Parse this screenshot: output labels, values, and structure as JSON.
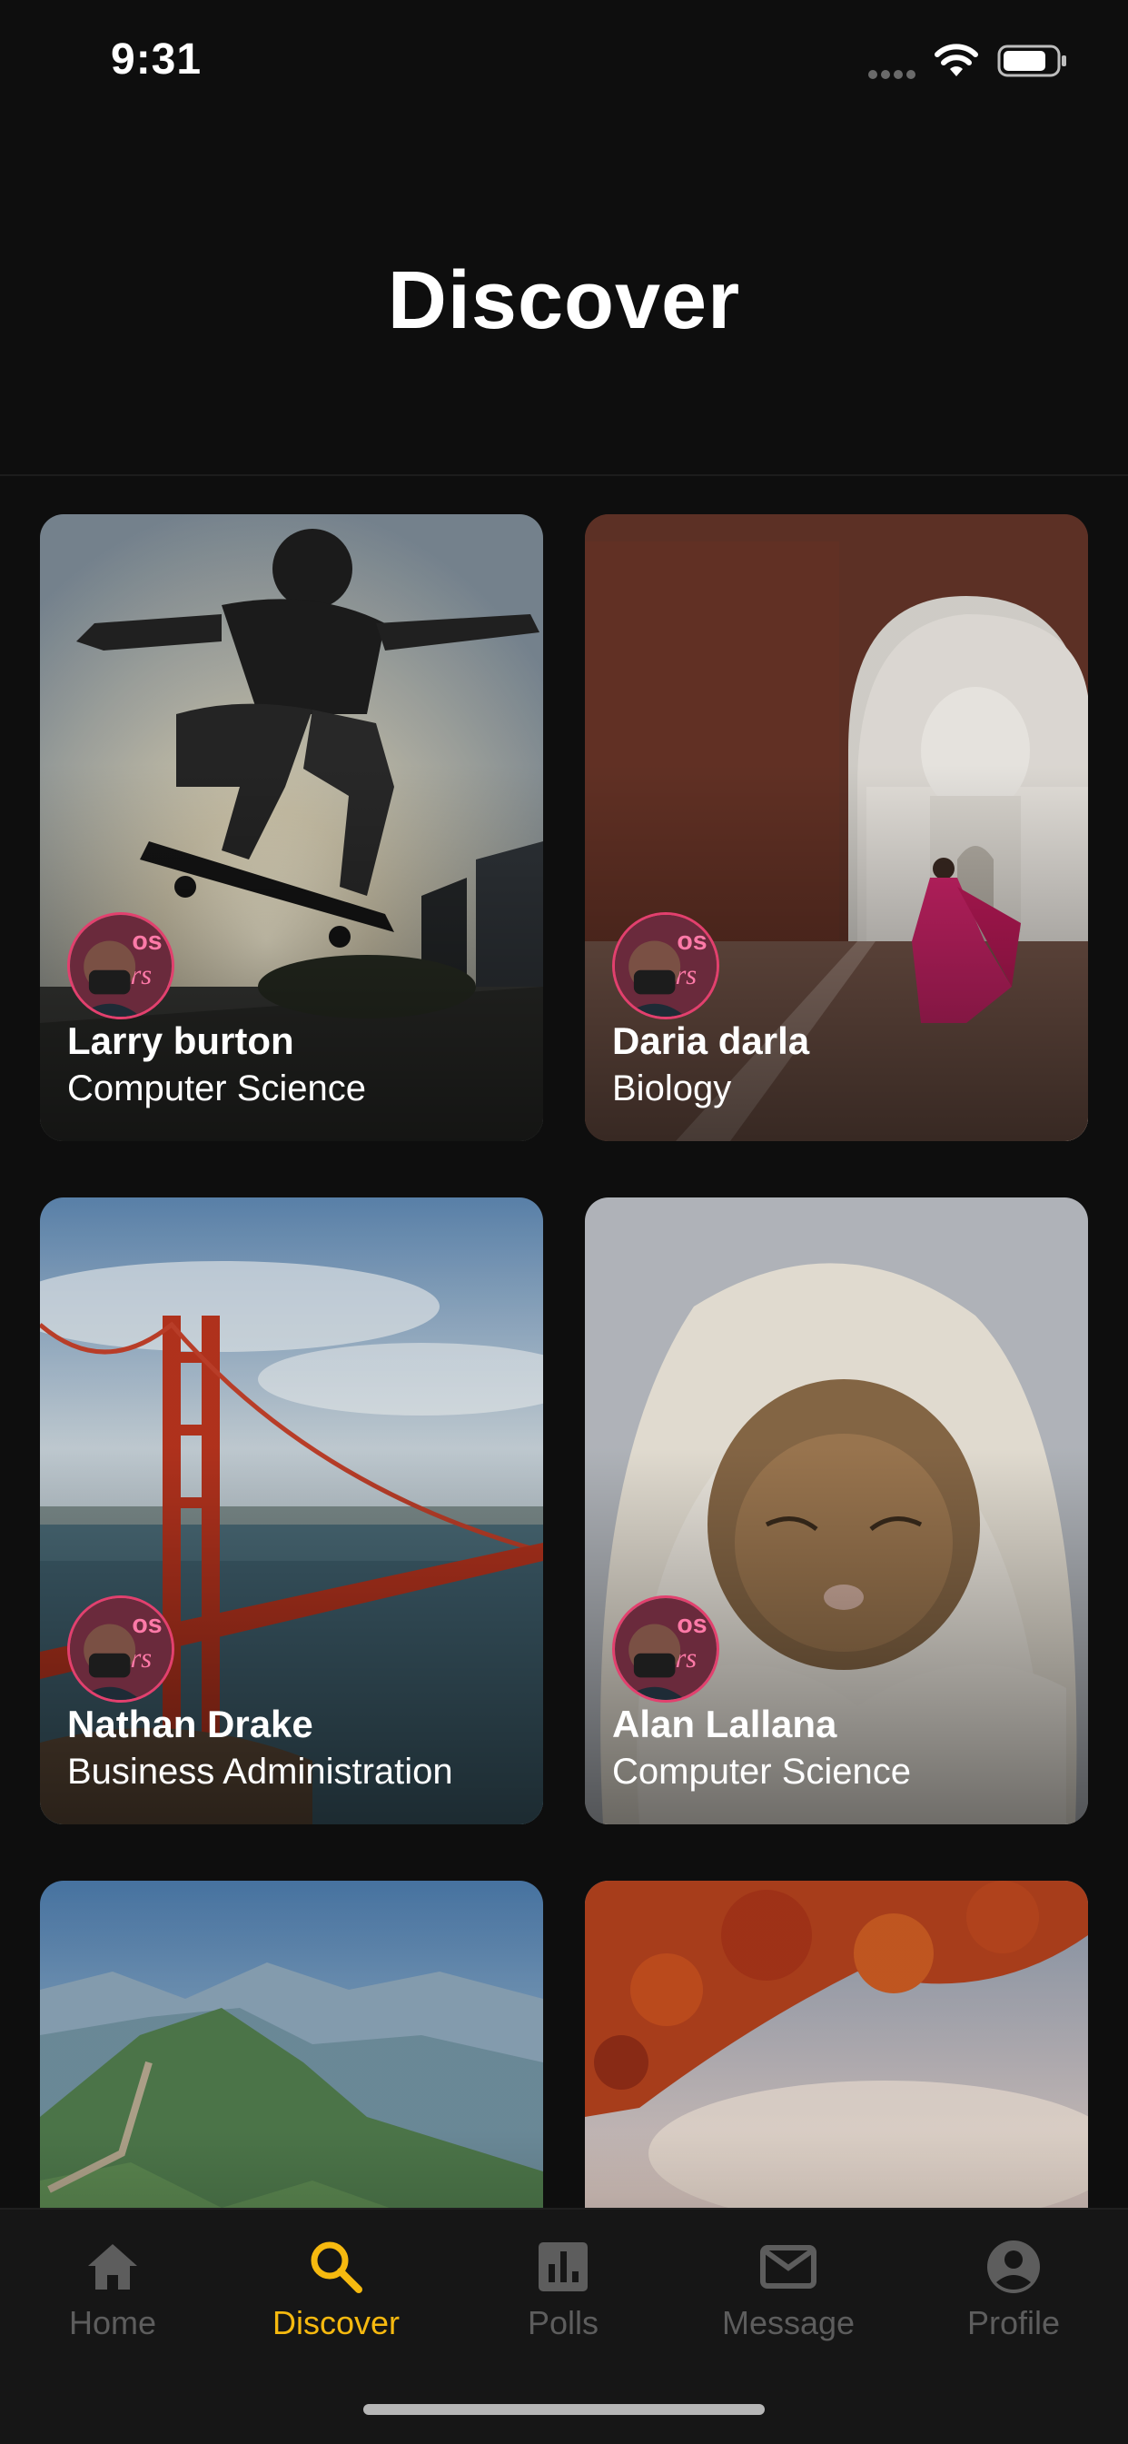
{
  "status_bar": {
    "time": "9:31"
  },
  "header": {
    "title": "Discover"
  },
  "cards": [
    {
      "name": "Larry burton",
      "major": "Computer Science",
      "image": "skateboarder-photo"
    },
    {
      "name": "Daria darla",
      "major": "Biology",
      "image": "taj-mahal-photo"
    },
    {
      "name": "Nathan Drake",
      "major": "Business Administration",
      "image": "golden-gate-bridge-photo"
    },
    {
      "name": "Alan Lallana",
      "major": "Computer Science",
      "image": "kitten-in-blanket-photo"
    },
    {
      "name": "",
      "major": "",
      "image": "great-wall-photo"
    },
    {
      "name": "",
      "major": "",
      "image": "autumn-leaves-photo"
    }
  ],
  "tab_bar": {
    "active": "Discover",
    "active_color": "#f6b90f",
    "inactive_color": "#5d5d5d",
    "tabs": [
      {
        "label": "Home",
        "icon": "home-icon"
      },
      {
        "label": "Discover",
        "icon": "search-icon"
      },
      {
        "label": "Polls",
        "icon": "poll-icon"
      },
      {
        "label": "Message",
        "icon": "mail-icon"
      },
      {
        "label": "Profile",
        "icon": "account-icon"
      }
    ]
  }
}
